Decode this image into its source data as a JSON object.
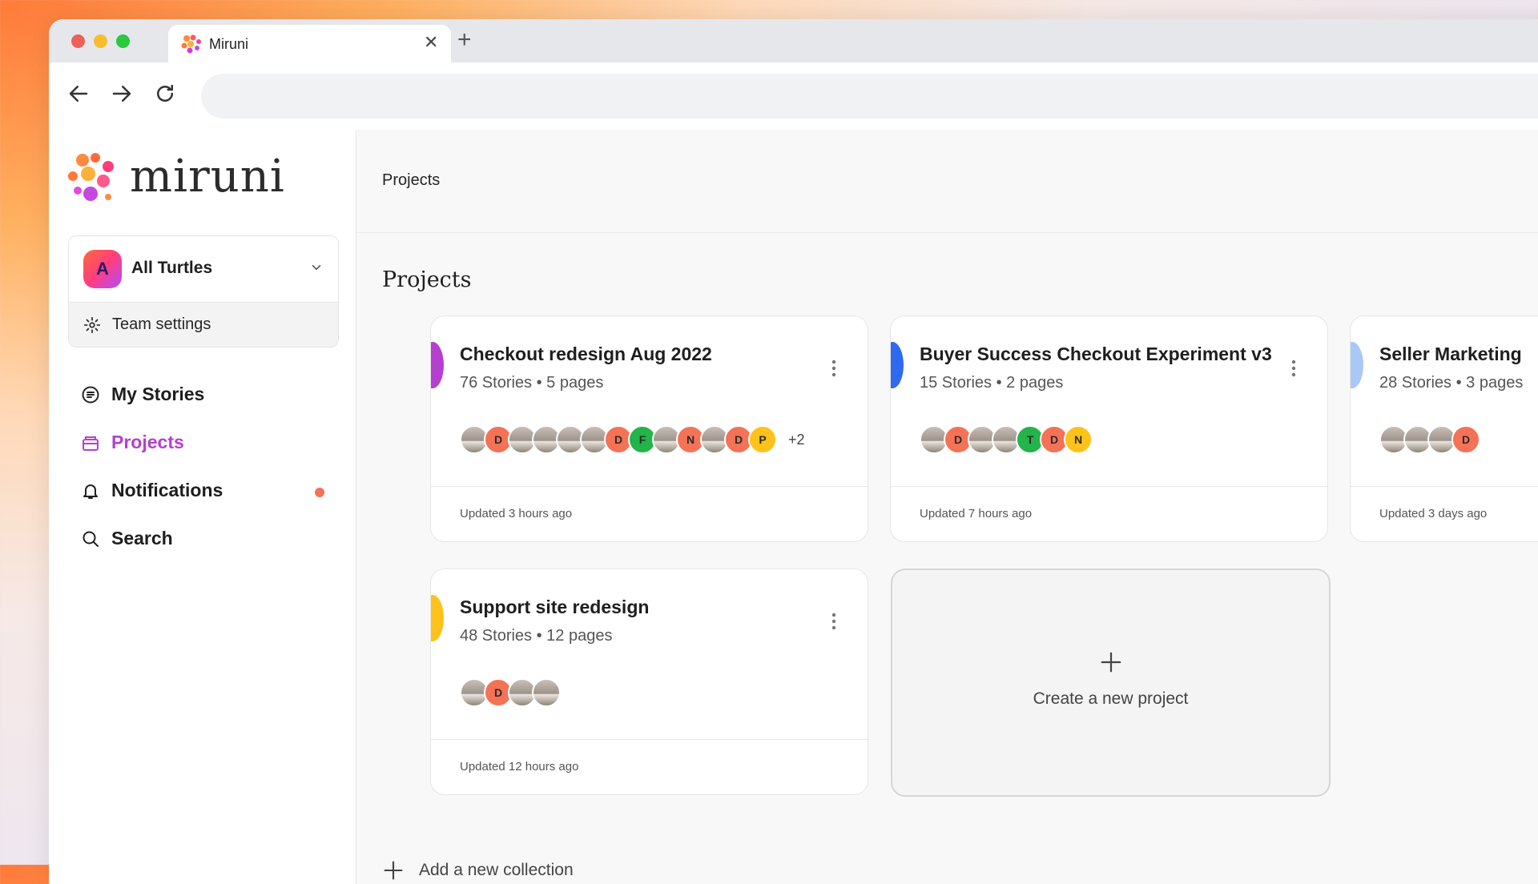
{
  "browser": {
    "tab_title": "Miruni",
    "url": ""
  },
  "colors": {
    "accent_purple": "#b53fcf",
    "accent_blue": "#2e6af0",
    "accent_yellow": "#ffc21a",
    "accent_lightblue": "#a9c8f5",
    "notif_dot": "#f47256"
  },
  "sidebar": {
    "logo_text": "miruni",
    "team": {
      "initial": "A",
      "name": "All Turtles",
      "settings_label": "Team settings"
    },
    "nav": [
      {
        "label": "My Stories",
        "icon": "stories-icon"
      },
      {
        "label": "Projects",
        "icon": "projects-icon",
        "active": true
      },
      {
        "label": "Notifications",
        "icon": "bell-icon"
      },
      {
        "label": "Search",
        "icon": "search-icon"
      }
    ]
  },
  "main": {
    "breadcrumb": "Projects",
    "heading": "Projects",
    "cards": [
      {
        "title": "Checkout redesign Aug 2022",
        "meta": "76 Stories • 5 pages",
        "updated": "Updated 3 hours ago",
        "avatars": [
          {
            "kind": "photo"
          },
          {
            "kind": "initial",
            "text": "D",
            "color": "#f47256"
          },
          {
            "kind": "photo"
          },
          {
            "kind": "photo"
          },
          {
            "kind": "photo"
          },
          {
            "kind": "photo"
          },
          {
            "kind": "initial",
            "text": "D",
            "color": "#f47256"
          },
          {
            "kind": "initial",
            "text": "F",
            "color": "#23b44a"
          },
          {
            "kind": "photo"
          },
          {
            "kind": "initial",
            "text": "N",
            "color": "#f47256"
          },
          {
            "kind": "photo"
          },
          {
            "kind": "initial",
            "text": "D",
            "color": "#f47256"
          },
          {
            "kind": "initial",
            "text": "P",
            "color": "#ffc21a"
          }
        ],
        "more": "+2"
      },
      {
        "title": "Buyer Success Checkout Experiment v3",
        "meta": "15 Stories • 2 pages",
        "updated": "Updated 7 hours ago",
        "avatars": [
          {
            "kind": "photo"
          },
          {
            "kind": "initial",
            "text": "D",
            "color": "#f47256"
          },
          {
            "kind": "photo"
          },
          {
            "kind": "photo"
          },
          {
            "kind": "initial",
            "text": "T",
            "color": "#23b44a"
          },
          {
            "kind": "initial",
            "text": "D",
            "color": "#f47256"
          },
          {
            "kind": "initial",
            "text": "N",
            "color": "#ffc21a"
          }
        ],
        "more": ""
      },
      {
        "title": "Seller Marketing",
        "meta": "28 Stories • 3 pages",
        "updated": "Updated 3 days ago",
        "avatars": [
          {
            "kind": "photo"
          },
          {
            "kind": "photo"
          },
          {
            "kind": "photo"
          },
          {
            "kind": "initial",
            "text": "D",
            "color": "#f47256"
          }
        ],
        "more": ""
      },
      {
        "title": "Support site redesign",
        "meta": "48 Stories • 12 pages",
        "updated": "Updated 12 hours ago",
        "avatars": [
          {
            "kind": "photo"
          },
          {
            "kind": "initial",
            "text": "D",
            "color": "#f47256"
          },
          {
            "kind": "photo"
          },
          {
            "kind": "photo"
          }
        ],
        "more": ""
      }
    ],
    "create_label": "Create a new project",
    "add_collection_label": "Add a new collection"
  }
}
